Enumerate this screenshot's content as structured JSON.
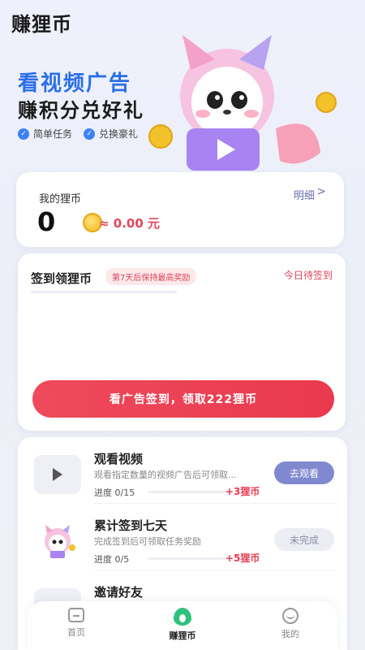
{
  "header": {
    "app_title": "赚狸币"
  },
  "hero": {
    "title": "看视频广告",
    "subtitle": "赚积分兑好礼",
    "tags": [
      "简单任务",
      "兑换豪礼"
    ]
  },
  "balance": {
    "label": "我的狸币",
    "value": "0",
    "equivalent": "≈ 0.00 元",
    "detail_label": "明细",
    "detail_chevron": ">"
  },
  "signin": {
    "title": "签到领狸币",
    "badge": "第7天后保持最高奖励",
    "status": "今日待签到",
    "button_label": "看广告签到，领取222狸币"
  },
  "tasks": [
    {
      "title": "观看视频",
      "description": "观看指定数量的视频广告后可领取...",
      "progress": "进度 0/15",
      "reward": "+3狸币",
      "action": "去观看",
      "progress_fraction": 0,
      "icon": "play-icon"
    },
    {
      "title": "累计签到七天",
      "description": "完成签到后可领取任务奖励",
      "progress": "进度 0/5",
      "reward": "+5狸币",
      "action": "未完成",
      "progress_fraction": 0,
      "icon": "fox-mascot-icon"
    },
    {
      "title": "邀请好友",
      "icon": "invite-icon"
    }
  ],
  "bottom_nav": {
    "items": [
      {
        "label": "首页",
        "icon": "home-icon"
      },
      {
        "label": "赚狸币",
        "icon": "flame-icon"
      },
      {
        "label": "我的",
        "icon": "user-icon"
      }
    ]
  },
  "colors": {
    "accent_red": "#e9394e",
    "accent_blue": "#2a6fe8",
    "button_purple": "#8089cf"
  }
}
